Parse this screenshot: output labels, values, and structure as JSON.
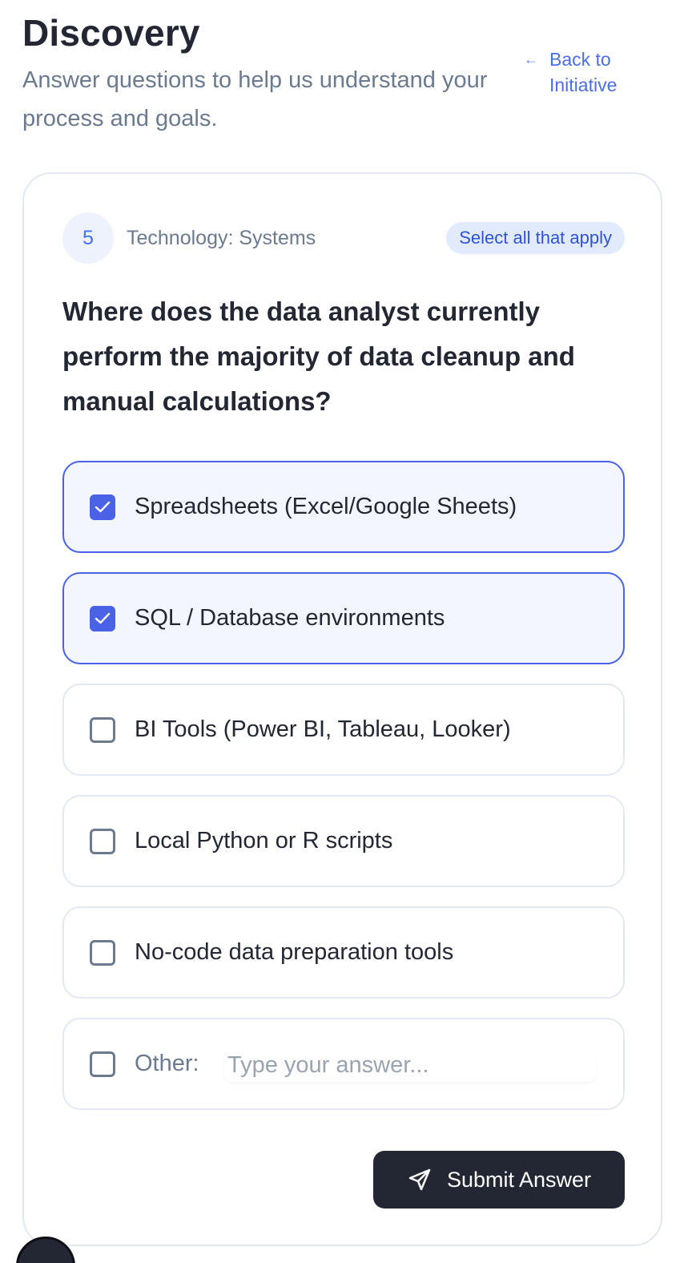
{
  "header": {
    "title": "Discovery",
    "subtitle": "Answer questions to help us understand your process and goals.",
    "back_link": "Back to Initiative"
  },
  "question": {
    "number": "5",
    "category": "Technology: Systems",
    "badge": "Select all that apply",
    "text": "Where does the data analyst currently perform the majority of data cleanup and manual calculations?",
    "options": [
      {
        "label": "Spreadsheets (Excel/Google Sheets)",
        "checked": true
      },
      {
        "label": "SQL / Database environments",
        "checked": true
      },
      {
        "label": "BI Tools (Power BI, Tableau, Looker)",
        "checked": false
      },
      {
        "label": "Local Python or R scripts",
        "checked": false
      },
      {
        "label": "No-code data preparation tools",
        "checked": false
      }
    ],
    "other": {
      "label": "Other:",
      "placeholder": "Type your answer...",
      "value": "",
      "checked": false
    }
  },
  "submit": {
    "label": "Submit Answer"
  },
  "colors": {
    "accent": "#4a63e6",
    "link": "#4a6ef0",
    "dark": "#232733",
    "muted": "#6b7a8f",
    "border": "#e3e9f2"
  }
}
